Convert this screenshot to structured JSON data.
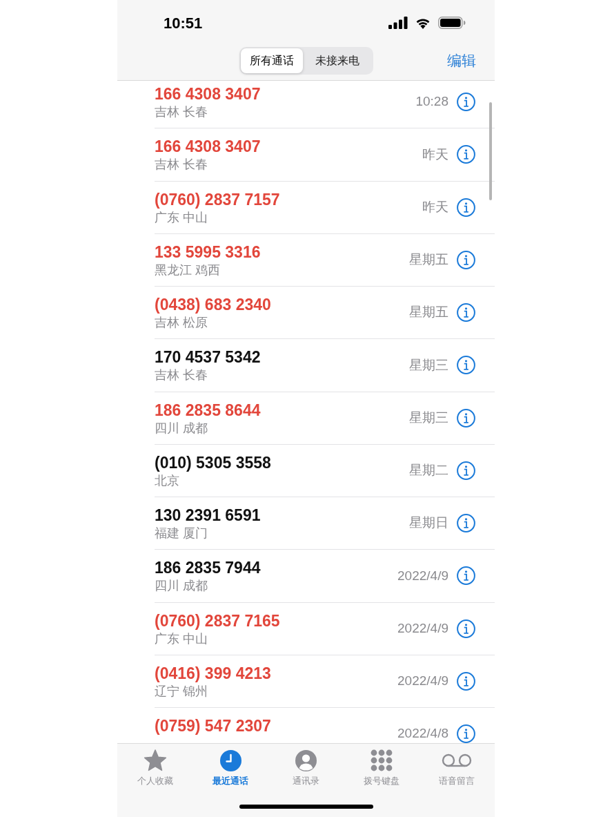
{
  "status_bar": {
    "time": "10:51"
  },
  "header": {
    "segments": [
      {
        "label": "所有通话",
        "selected": true
      },
      {
        "label": "未接来电",
        "selected": false
      }
    ],
    "edit_button": "编辑"
  },
  "calls": [
    {
      "number": "166 4308 3407",
      "location": "吉林 长春",
      "time": "10:28",
      "missed": true
    },
    {
      "number": "166 4308 3407",
      "location": "吉林 长春",
      "time": "昨天",
      "missed": true
    },
    {
      "number": "(0760) 2837 7157",
      "location": "广东 中山",
      "time": "昨天",
      "missed": true
    },
    {
      "number": "133 5995 3316",
      "location": "黑龙江 鸡西",
      "time": "星期五",
      "missed": true
    },
    {
      "number": "(0438) 683 2340",
      "location": "吉林 松原",
      "time": "星期五",
      "missed": true
    },
    {
      "number": "170 4537 5342",
      "location": "吉林 长春",
      "time": "星期三",
      "missed": false
    },
    {
      "number": "186 2835 8644",
      "location": "四川 成都",
      "time": "星期三",
      "missed": true
    },
    {
      "number": "(010) 5305 3558",
      "location": "北京",
      "time": "星期二",
      "missed": false
    },
    {
      "number": "130 2391 6591",
      "location": "福建 厦门",
      "time": "星期日",
      "missed": false
    },
    {
      "number": "186 2835 7944",
      "location": "四川 成都",
      "time": "2022/4/9",
      "missed": false
    },
    {
      "number": "(0760) 2837 7165",
      "location": "广东 中山",
      "time": "2022/4/9",
      "missed": true
    },
    {
      "number": "(0416) 399 4213",
      "location": "辽宁 锦州",
      "time": "2022/4/9",
      "missed": true
    },
    {
      "number": "(0759) 547 2307",
      "time": "2022/4/8",
      "missed": true
    }
  ],
  "tab_bar": [
    {
      "label": "个人收藏",
      "selected": false
    },
    {
      "label": "最近通话",
      "selected": true
    },
    {
      "label": "通讯录",
      "selected": false
    },
    {
      "label": "拨号键盘",
      "selected": false
    },
    {
      "label": "语音留言",
      "selected": false
    }
  ]
}
